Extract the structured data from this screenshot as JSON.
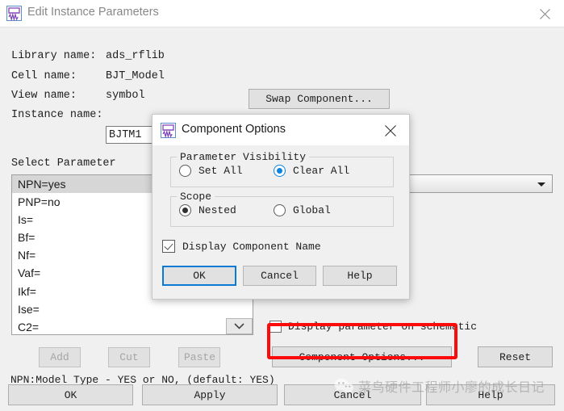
{
  "main_window": {
    "title": "Edit Instance Parameters",
    "icon": "waveform-app-icon",
    "close_icon": "close-icon",
    "fields": [
      {
        "label": "Library name:",
        "value": "ads_rflib"
      },
      {
        "label": "Cell name:",
        "value": "BJT_Model"
      },
      {
        "label": "View name:",
        "value": "symbol"
      },
      {
        "label": "Instance name:",
        "value": "BJTM1"
      }
    ],
    "swap_component_label": "Swap Component...",
    "select_parameter_label": "Select Parameter",
    "parameters": [
      {
        "text": "NPN=yes",
        "selected": true
      },
      {
        "text": "PNP=no",
        "selected": false
      },
      {
        "text": "Is=",
        "selected": false
      },
      {
        "text": "Bf=",
        "selected": false
      },
      {
        "text": "Nf=",
        "selected": false
      },
      {
        "text": "Vaf=",
        "selected": false
      },
      {
        "text": "Ikf=",
        "selected": false
      },
      {
        "text": "Ise=",
        "selected": false
      },
      {
        "text": "C2=",
        "selected": false
      }
    ],
    "value_combo_value": "",
    "display_param_label": "Display parameter on schematic",
    "display_param_checked": false,
    "edit_buttons": [
      {
        "label": "Add",
        "enabled": false
      },
      {
        "label": "Cut",
        "enabled": false
      },
      {
        "label": "Paste",
        "enabled": false
      }
    ],
    "component_options_label": "Component Options...",
    "reset_label": "Reset",
    "hint_text": "NPN:Model Type - YES or NO, (default: YES)",
    "bottom_buttons": {
      "ok": "OK",
      "apply": "Apply",
      "cancel": "Cancel",
      "help": "Help"
    },
    "highlight_color": "#fb0b0b"
  },
  "component_options_dialog": {
    "title": "Component Options",
    "icon": "waveform-app-icon",
    "close_icon": "close-icon",
    "visibility_group_title": "Parameter Visibility",
    "visibility_options": [
      {
        "label": "Set All",
        "selected": false
      },
      {
        "label": "Clear All",
        "selected": true
      }
    ],
    "scope_group_title": "Scope",
    "scope_options": [
      {
        "label": "Nested",
        "selected": true
      },
      {
        "label": "Global",
        "selected": false
      }
    ],
    "display_component_name_label": "Display Component Name",
    "display_component_name_checked": true,
    "buttons": {
      "ok": "OK",
      "cancel": "Cancel",
      "help": "Help"
    },
    "focus_color": "#0a7ad4"
  },
  "watermark": {
    "text": "菜鸟硬件工程师小廖的成长日记",
    "logo": "wechat-logo"
  }
}
